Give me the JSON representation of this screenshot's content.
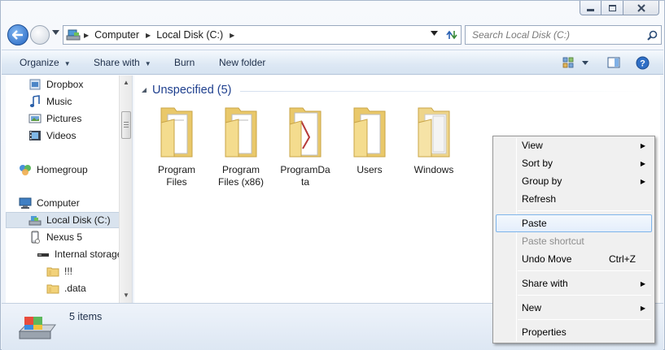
{
  "window": {
    "minimize_symbol": "▁",
    "maximize_symbol": "□",
    "close_symbol": "✕"
  },
  "address_bar": {
    "breadcrumbs": [
      "Computer",
      "Local Disk (C:)"
    ],
    "search_placeholder": "Search Local Disk (C:)"
  },
  "toolbar": {
    "organize": "Organize",
    "share_with": "Share with",
    "burn": "Burn",
    "new_folder": "New folder"
  },
  "nav_pane": {
    "items": [
      {
        "label": "Dropbox",
        "icon": "dropbox-icon"
      },
      {
        "label": "Music",
        "icon": "music-icon"
      },
      {
        "label": "Pictures",
        "icon": "pictures-icon"
      },
      {
        "label": "Videos",
        "icon": "videos-icon"
      },
      {
        "label": "Homegroup",
        "icon": "homegroup-icon"
      },
      {
        "label": "Computer",
        "icon": "computer-icon"
      },
      {
        "label": "Local Disk (C:)",
        "icon": "drive-icon",
        "selected": true
      },
      {
        "label": "Nexus 5",
        "icon": "phone-icon"
      },
      {
        "label": "Internal storage",
        "icon": "storage-icon"
      },
      {
        "label": "!!!",
        "icon": "folder-icon"
      },
      {
        "label": ".data",
        "icon": "folder-icon"
      }
    ]
  },
  "content": {
    "group_title": "Unspecified (5)",
    "files": [
      {
        "line1": "Program",
        "line2": "Files"
      },
      {
        "line1": "Program",
        "line2": "Files (x86)"
      },
      {
        "line1": "ProgramDa",
        "line2": "ta"
      },
      {
        "line1": "Users",
        "line2": ""
      },
      {
        "line1": "Windows",
        "line2": ""
      }
    ]
  },
  "status_bar": {
    "item_count": "5 items"
  },
  "context_menu": {
    "items": [
      {
        "label": "View",
        "submenu": true
      },
      {
        "label": "Sort by",
        "submenu": true
      },
      {
        "label": "Group by",
        "submenu": true
      },
      {
        "label": "Refresh"
      },
      {
        "label": "Paste",
        "highlighted": true
      },
      {
        "label": "Paste shortcut",
        "disabled": true
      },
      {
        "label": "Undo Move",
        "shortcut": "Ctrl+Z"
      },
      {
        "label": "Share with",
        "submenu": true
      },
      {
        "label": "New",
        "submenu": true
      },
      {
        "label": "Properties"
      }
    ],
    "submenu_arrow": "▶"
  },
  "colors": {
    "accent_blue": "#1e3f8e",
    "folder_yellow": "#f2d77e",
    "toolbar_bg": "#dde8f4"
  }
}
